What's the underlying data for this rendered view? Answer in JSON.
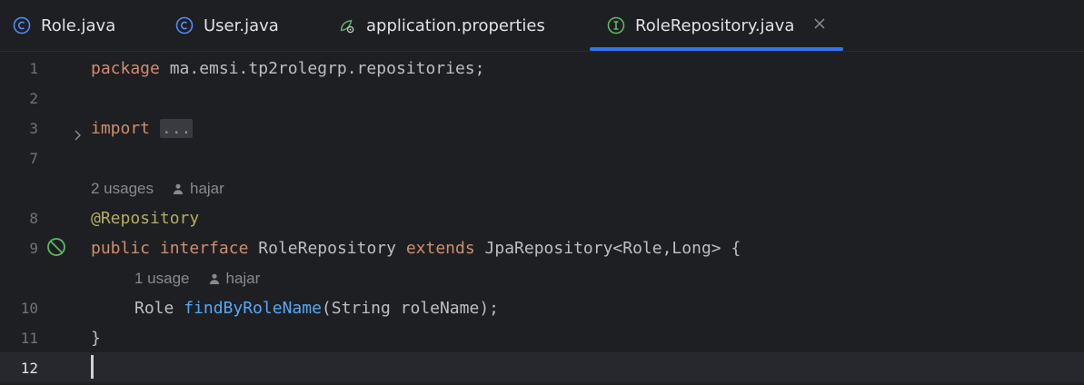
{
  "tabs": [
    {
      "label": "Role.java",
      "icon": "class-icon"
    },
    {
      "label": "User.java",
      "icon": "class-icon"
    },
    {
      "label": "application.properties",
      "icon": "spring-properties-icon"
    },
    {
      "label": "RoleRepository.java",
      "icon": "interface-icon",
      "active": true
    }
  ],
  "editor": {
    "lines": {
      "l1": {
        "num": "1",
        "kw": "package",
        "text": " ma.emsi.tp2rolegrp.repositories;"
      },
      "l2": {
        "num": "2"
      },
      "l3": {
        "num": "3",
        "kw": "import",
        "fold": "..."
      },
      "l7": {
        "num": "7"
      },
      "l8": {
        "num": "8",
        "annotation": "@Repository"
      },
      "l9": {
        "num": "9",
        "kw1": "public",
        "kw2": "interface",
        "name": "RoleRepository",
        "kw3": "extends",
        "rest": "JpaRepository<Role,Long> {"
      },
      "l10": {
        "num": "10",
        "type": "Role",
        "method": "findByRoleName",
        "params": "(String roleName);"
      },
      "l11": {
        "num": "11",
        "text": "}"
      },
      "l12": {
        "num": "12"
      }
    },
    "hints": {
      "class_usages": "2 usages",
      "class_author": "hajar",
      "method_usages": "1 usage",
      "method_author": "hajar"
    }
  },
  "colors": {
    "background": "#1e1f22",
    "keyword": "#cf8e6d",
    "annotation": "#b3ae60",
    "method": "#56a8f5",
    "tab_underline": "#3574f0"
  }
}
